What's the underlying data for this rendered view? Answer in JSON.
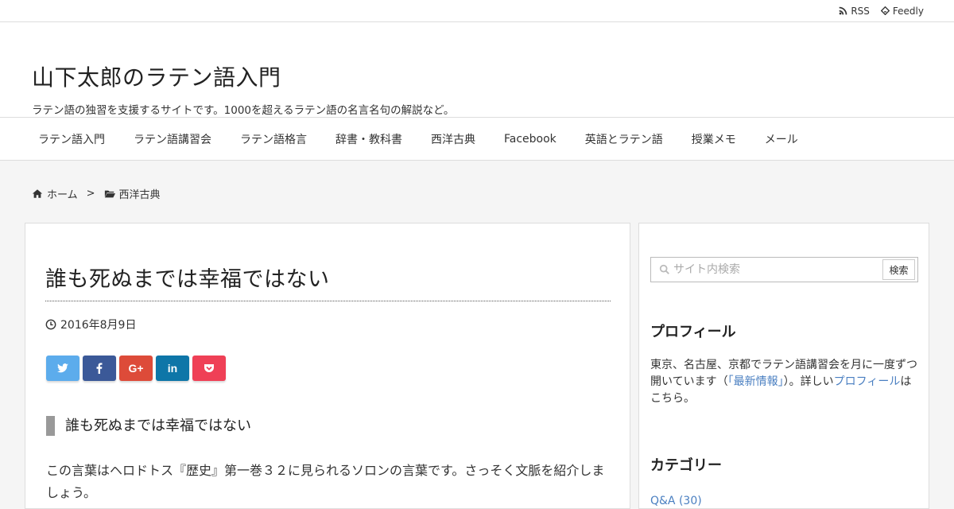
{
  "topbar": {
    "links": [
      {
        "label": "RSS",
        "icon": "rss-icon"
      },
      {
        "label": "Feedly",
        "icon": "feedly-icon"
      }
    ]
  },
  "header": {
    "title": "山下太郎のラテン語入門",
    "description": "ラテン語の独習を支援するサイトです。1000を超えるラテン語の名言名句の解説など。"
  },
  "nav": {
    "items": [
      "ラテン語入門",
      "ラテン語講習会",
      "ラテン語格言",
      "辞書・教科書",
      "西洋古典",
      "Facebook",
      "英語とラテン語",
      "授業メモ",
      "メール"
    ]
  },
  "breadcrumb": {
    "home": "ホーム",
    "separator": ">",
    "category": "西洋古典"
  },
  "post": {
    "title": "誰も死ぬまでは幸福ではない",
    "date": "2016年8月9日",
    "share": [
      {
        "name": "twitter",
        "color": "#5cacec",
        "label": ""
      },
      {
        "name": "facebook",
        "color": "#3b5998",
        "label": ""
      },
      {
        "name": "google-plus",
        "color": "#dd4b39",
        "label": "G+"
      },
      {
        "name": "linkedin",
        "color": "#0e76a8",
        "label": "in"
      },
      {
        "name": "pocket",
        "color": "#ef4056",
        "label": ""
      }
    ],
    "heading": "誰も死ぬまでは幸福ではない",
    "body": "この言葉はヘロドトス『歴史』第一巻３２に見られるソロンの言葉です。さっそく文脈を紹介しましょう。"
  },
  "sidebar": {
    "search": {
      "placeholder": "サイト内検索",
      "button": "検索"
    },
    "profile": {
      "title": "プロフィール",
      "text_1": "東京、名古屋、京都でラテン語講習会を月に一度ずつ開いています（",
      "link_1": "「最新情報」",
      "text_2": "）。詳しい",
      "link_2": "プロフィール",
      "text_3": "はこちら。"
    },
    "categories": {
      "title": "カテゴリー",
      "first_item": "Q&A (30)"
    }
  }
}
